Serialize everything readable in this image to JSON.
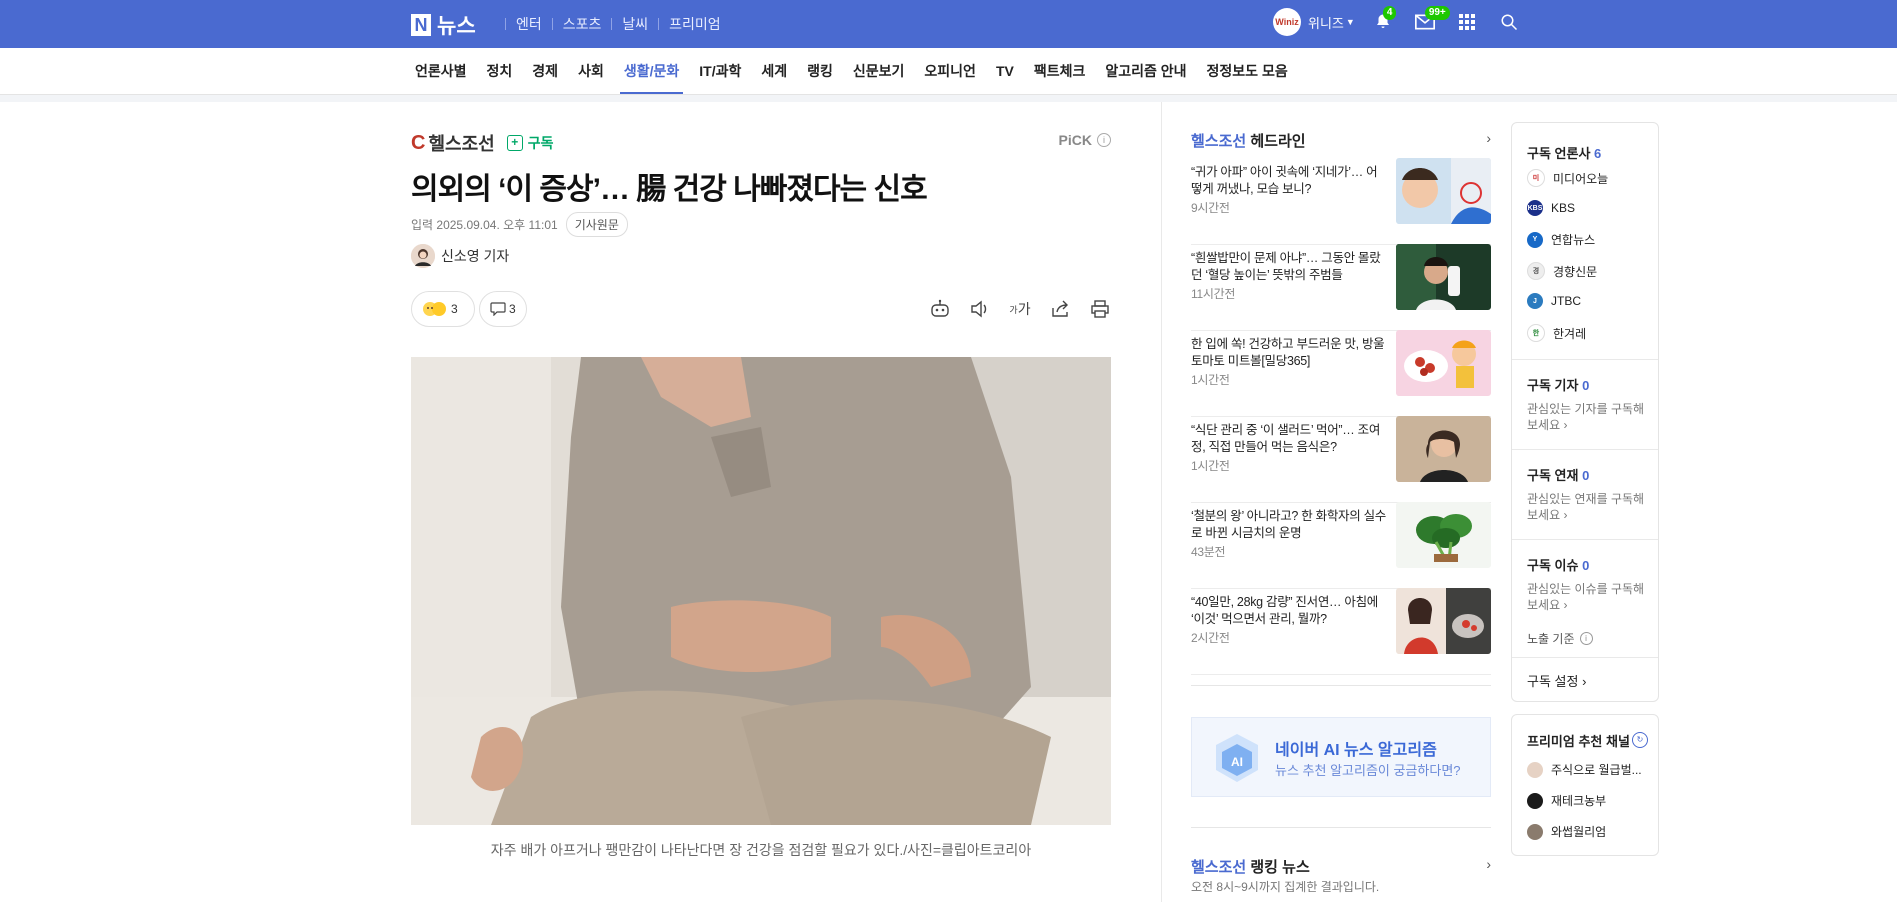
{
  "topbar": {
    "logo_letter": "N",
    "logo_text": "뉴스",
    "nav": [
      "엔터",
      "스포츠",
      "날씨",
      "프리미엄"
    ],
    "avatar_text": "Winiz",
    "username": "위니즈",
    "notifications_badge": "4",
    "mail_badge": "99+"
  },
  "categories": [
    "언론사별",
    "정치",
    "경제",
    "사회",
    "생활/문화",
    "IT/과학",
    "세계",
    "랭킹",
    "신문보기",
    "오피니언",
    "TV",
    "팩트체크",
    "알고리즘 안내",
    "정정보도 모음"
  ],
  "active_category": "생활/문화",
  "article": {
    "press": "헬스조선",
    "subscribe": "구독",
    "pick": "PiCK",
    "title": "의외의 ‘이 증상’… 腸 건강 나빠졌다는 신호",
    "date": "입력 2025.09.04. 오후 11:01",
    "origin_button": "기사원문",
    "reporter": "신소영 기자",
    "reaction_count": "3",
    "comment_count": "3",
    "font_tool": "가",
    "caption": "자주 배가 아프거나 팽만감이 나타난다면 장 건강을 점검할 필요가 있다./사진=클립아트코리아"
  },
  "headline": {
    "brand": "헬스조선",
    "label": "헤드라인",
    "items": [
      {
        "text": "“귀가 아파” 아이 귓속에 ‘지네가’… 어떻게 꺼냈나, 모습 보니?",
        "time": "9시간전"
      },
      {
        "text": "“흰쌀밥만이 문제 아냐”… 그동안 몰랐던 ‘혈당 높이는’ 뜻밖의 주범들",
        "time": "11시간전"
      },
      {
        "text": "한 입에 쏙! 건강하고 부드러운 맛, 방울토마토 미트볼[밀당365]",
        "time": "1시간전"
      },
      {
        "text": "“식단 관리 중 ‘이 샐러드’ 먹어”… 조여정, 직접 만들어 먹는 음식은?",
        "time": "1시간전"
      },
      {
        "text": "‘철분의 왕’ 아니라고? 한 화학자의 실수로 바뀐 시금치의 운명",
        "time": "43분전"
      },
      {
        "text": "“40일만, 28kg 감량” 진서연… 아침에 ‘이것’ 먹으면서 관리, 뭘까?",
        "time": "2시간전"
      }
    ],
    "ai_title": "네이버 AI 뉴스 알고리즘",
    "ai_sub": "뉴스 추천 알고리즘이 궁금하다면?",
    "ai_icon_text": "AI",
    "ranking_brand": "헬스조선",
    "ranking_label": "랭킹 뉴스",
    "ranking_sub": "오전 8시~9시까지 집계한 결과입니다."
  },
  "subscriptions": {
    "press_title": "구독 언론사",
    "press_count": "6",
    "press_list": [
      {
        "name": "미디어오늘",
        "color": "#ffffff",
        "icon": "미"
      },
      {
        "name": "KBS",
        "color": "#1a2f8a",
        "icon": "KBS"
      },
      {
        "name": "연합뉴스",
        "color": "#1769c7",
        "icon": "Y"
      },
      {
        "name": "경향신문",
        "color": "#e8e8e8",
        "icon": "경"
      },
      {
        "name": "JTBC",
        "color": "#2b7bbf",
        "icon": "J"
      },
      {
        "name": "한겨레",
        "color": "#ffffff",
        "icon": "한"
      }
    ],
    "reporter_title": "구독 기자",
    "reporter_count": "0",
    "reporter_desc": "관심있는 기자를 구독해 보세요",
    "series_title": "구독 연재",
    "series_count": "0",
    "series_desc": "관심있는 연재를 구독해 보세요",
    "issue_title": "구독 이슈",
    "issue_count": "0",
    "issue_desc": "관심있는 이슈를 구독해 보세요",
    "exposure": "노출 기준",
    "settings": "구독 설정"
  },
  "premium": {
    "title": "프리미엄 추천 채널",
    "channels": [
      "주식으로 월급벌...",
      "재테크농부",
      "와썹월리엄"
    ]
  }
}
